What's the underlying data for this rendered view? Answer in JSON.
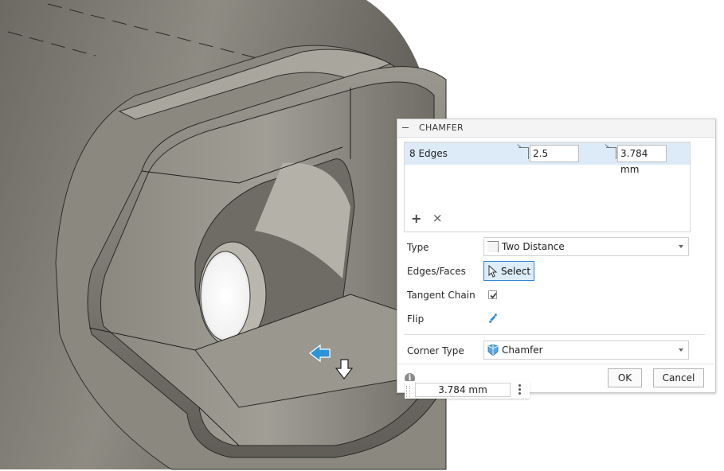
{
  "panel": {
    "title": "CHAMFER",
    "selection": {
      "edge_count": "8 Edges",
      "distance_one": "2.5",
      "distance_two": "3.784 mm"
    },
    "fields": {
      "type_label": "Type",
      "type_value": "Two Distance",
      "edges_label": "Edges/Faces",
      "select_label": "Select",
      "tangent_label": "Tangent Chain",
      "tangent_checked": true,
      "flip_label": "Flip",
      "corner_label": "Corner Type",
      "corner_value": "Chamfer"
    },
    "buttons": {
      "ok": "OK",
      "cancel": "Cancel"
    },
    "icons": {
      "add": "+",
      "remove": "×",
      "info": "i"
    }
  },
  "canvas": {
    "floating_value": "3.784 mm"
  },
  "colors": {
    "accent": "#2f84d1",
    "selection_row": "#dcebf7",
    "model_body": "#7d7b72",
    "manipulator_arrow": "#2d93d8"
  }
}
